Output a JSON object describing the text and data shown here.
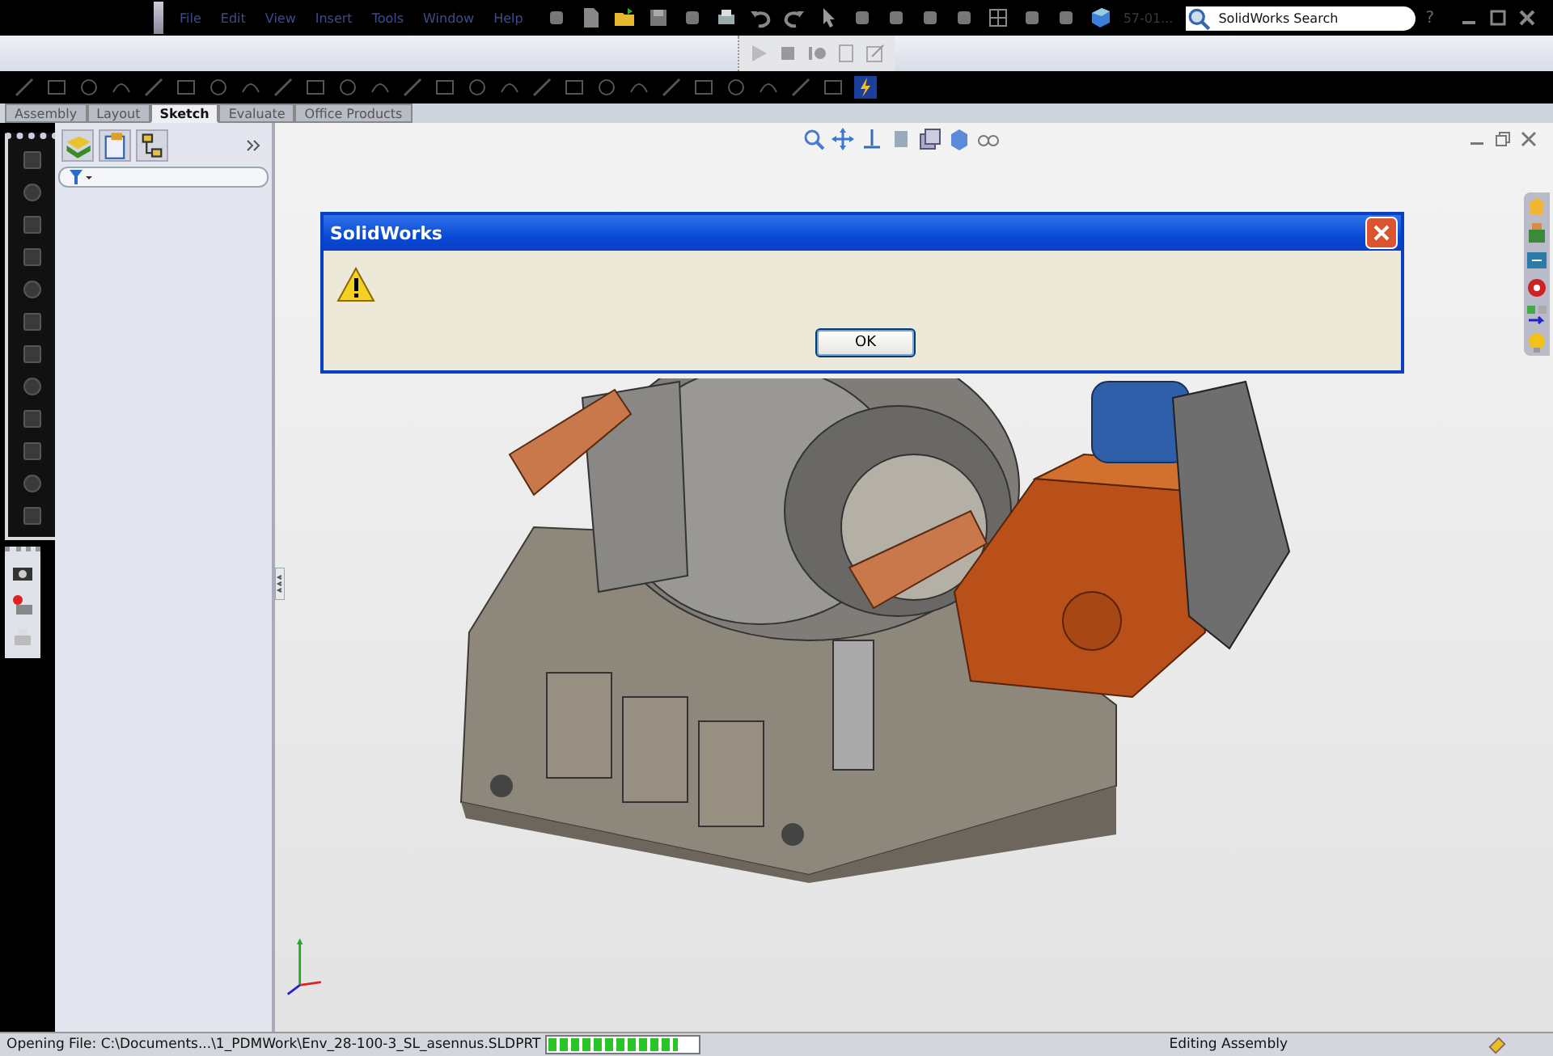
{
  "menu": [
    {
      "label": "File"
    },
    {
      "label": "Edit"
    },
    {
      "label": "View"
    },
    {
      "label": "Insert"
    },
    {
      "label": "Tools"
    },
    {
      "label": "Window"
    },
    {
      "label": "Help"
    }
  ],
  "document_label": "57-01...",
  "search": {
    "placeholder": "SolidWorks Search"
  },
  "help_label": "?",
  "command_tabs": [
    {
      "label": "Assembly",
      "selected": false
    },
    {
      "label": "Layout",
      "selected": false
    },
    {
      "label": "Sketch",
      "selected": true
    },
    {
      "label": "Evaluate",
      "selected": false
    },
    {
      "label": "Office Products",
      "selected": false
    }
  ],
  "dialog": {
    "title": "SolidWorks",
    "button": "OK"
  },
  "status_bar": {
    "message": "Opening File: C:\\Documents...\\1_PDMWork\\Env_28-100-3_SL_asennus.SLDPRT",
    "progress": {
      "level": 0.87
    },
    "mode": "Editing Assembly"
  }
}
